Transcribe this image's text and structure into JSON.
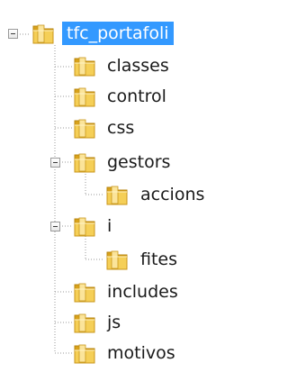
{
  "tree": {
    "root": {
      "label": "tfc_portafoli",
      "selected": true,
      "expanded": true
    },
    "items": [
      {
        "label": "classes",
        "level": 1
      },
      {
        "label": "control",
        "level": 1
      },
      {
        "label": "css",
        "level": 1
      },
      {
        "label": "gestors",
        "level": 1,
        "expanded": true
      },
      {
        "label": "accions",
        "level": 2
      },
      {
        "label": "i",
        "level": 1,
        "expanded": true
      },
      {
        "label": "fites",
        "level": 2
      },
      {
        "label": "includes",
        "level": 1
      },
      {
        "label": "js",
        "level": 1
      },
      {
        "label": "motivos",
        "level": 1
      }
    ]
  },
  "colors": {
    "selection": "#3399ff",
    "folder": "#f2c94c",
    "guide": "#9a9a9a"
  },
  "icons": {
    "folder": "folder-icon",
    "collapse": "collapse-toggle-icon"
  }
}
